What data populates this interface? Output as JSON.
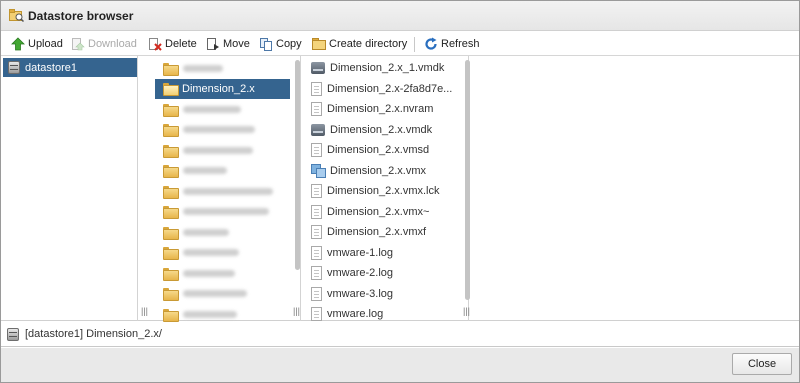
{
  "window": {
    "title": "Datastore browser",
    "icon": "datastore-browser-icon"
  },
  "toolbar": {
    "upload": {
      "label": "Upload",
      "icon": "upload-icon",
      "color": "#3a9c2e"
    },
    "download": {
      "label": "Download",
      "icon": "download-icon",
      "disabled": true
    },
    "delete": {
      "label": "Delete",
      "icon": "delete-icon",
      "color": "#cc2a1f"
    },
    "move": {
      "label": "Move",
      "icon": "move-icon"
    },
    "copy": {
      "label": "Copy",
      "icon": "copy-icon"
    },
    "create_directory": {
      "label": "Create directory",
      "icon": "new-folder-icon"
    },
    "refresh": {
      "label": "Refresh",
      "icon": "refresh-icon",
      "color": "#2a6fbf"
    }
  },
  "datastores": [
    {
      "label": "datastore1",
      "selected": true
    }
  ],
  "directories": [
    {
      "label": "",
      "redacted": true
    },
    {
      "label": "Dimension_2.x",
      "selected": true
    },
    {
      "label": "",
      "redacted": true
    },
    {
      "label": "",
      "redacted": true
    },
    {
      "label": "",
      "redacted": true
    },
    {
      "label": "",
      "redacted": true
    },
    {
      "label": "",
      "redacted": true
    },
    {
      "label": "",
      "redacted": true
    },
    {
      "label": "",
      "redacted": true
    },
    {
      "label": "",
      "redacted": true
    },
    {
      "label": "",
      "redacted": true
    },
    {
      "label": "",
      "redacted": true
    },
    {
      "label": "",
      "redacted": true
    }
  ],
  "files": [
    {
      "label": "Dimension_2.x_1.vmdk",
      "icon": "disk-icon"
    },
    {
      "label": "Dimension_2.x-2fa8d7e...",
      "icon": "file-icon"
    },
    {
      "label": "Dimension_2.x.nvram",
      "icon": "file-icon"
    },
    {
      "label": "Dimension_2.x.vmdk",
      "icon": "disk-icon"
    },
    {
      "label": "Dimension_2.x.vmsd",
      "icon": "file-icon"
    },
    {
      "label": "Dimension_2.x.vmx",
      "icon": "vm-config-icon"
    },
    {
      "label": "Dimension_2.x.vmx.lck",
      "icon": "file-icon"
    },
    {
      "label": "Dimension_2.x.vmx~",
      "icon": "file-icon"
    },
    {
      "label": "Dimension_2.x.vmxf",
      "icon": "file-icon"
    },
    {
      "label": "vmware-1.log",
      "icon": "log-icon"
    },
    {
      "label": "vmware-2.log",
      "icon": "log-icon"
    },
    {
      "label": "vmware-3.log",
      "icon": "log-icon"
    },
    {
      "label": "vmware.log",
      "icon": "log-icon"
    }
  ],
  "status": {
    "path": "[datastore1] Dimension_2.x/"
  },
  "footer": {
    "close_label": "Close"
  },
  "colors": {
    "selection": "#35648f",
    "footer": "#e9e9e9"
  }
}
